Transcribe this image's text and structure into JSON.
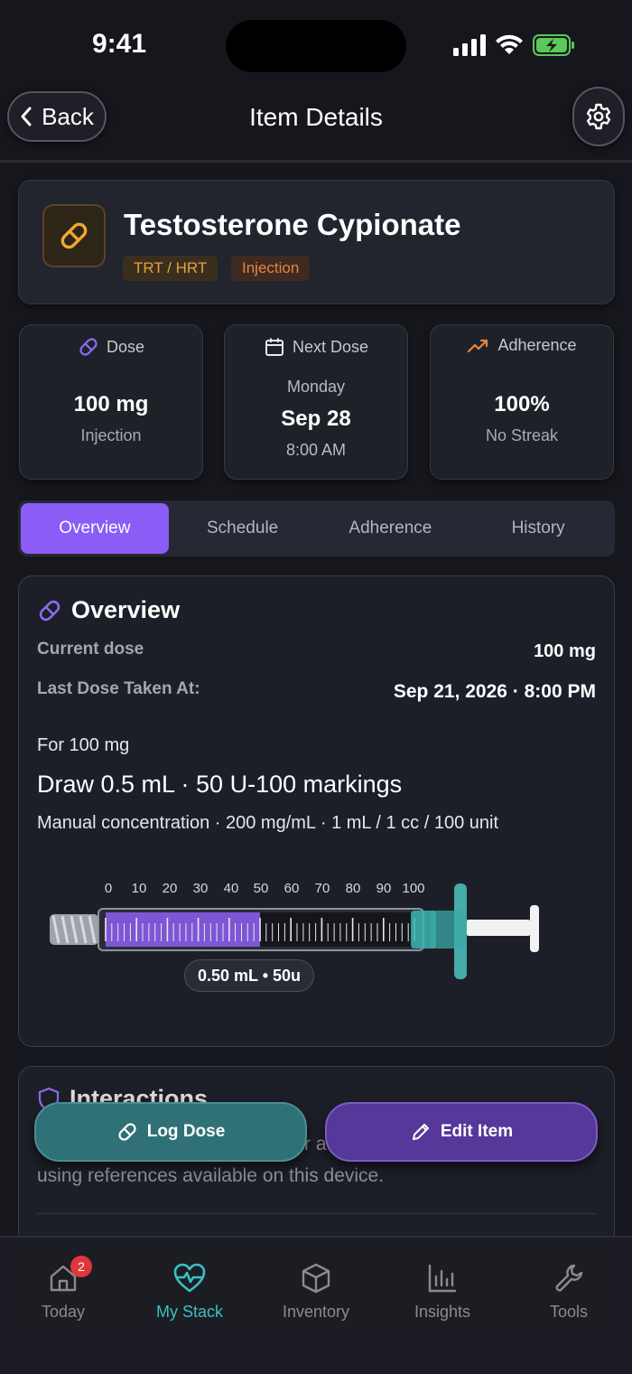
{
  "status_bar": {
    "time": "9:41"
  },
  "header": {
    "back_label": "Back",
    "title": "Item Details"
  },
  "item": {
    "name": "Testosterone Cypionate",
    "tags": [
      "TRT / HRT",
      "Injection"
    ],
    "icon": "pill-icon",
    "accent": "#e7a13a"
  },
  "stats": {
    "dose": {
      "label": "Dose",
      "value": "100 mg",
      "sub": "Injection"
    },
    "next_dose": {
      "label": "Next Dose",
      "day": "Monday",
      "date": "Sep 28",
      "time": "8:00 AM"
    },
    "adherence": {
      "label": "Adherence",
      "value": "100%",
      "sub": "No Streak"
    }
  },
  "tabs": [
    "Overview",
    "Schedule",
    "Adherence",
    "History"
  ],
  "active_tab": "Overview",
  "overview": {
    "title": "Overview",
    "current_dose_label": "Current dose",
    "current_dose_value": "100 mg",
    "last_dose_label": "Last Dose Taken At:",
    "last_dose_value": "Sep 21, 2026 · 8:00 PM",
    "for_line": "For 100 mg",
    "draw_line": "Draw 0.5 mL · 50 U-100 markings",
    "concentration_line": "Manual concentration · 200 mg/mL · 1 mL / 1 cc / 100 unit",
    "syringe": {
      "tick_labels": [
        "0",
        "10",
        "20",
        "30",
        "40",
        "50",
        "60",
        "70",
        "80",
        "90",
        "100"
      ],
      "fill_units": 50,
      "max_units": 100,
      "pill": "0.50 mL • 50u",
      "fill_color": "#7d56d6"
    }
  },
  "interactions": {
    "title": "Interactions",
    "text_fragment_1": "r a",
    "text_line_2": "using references available on this device."
  },
  "actions": {
    "log_dose": "Log Dose",
    "edit_item": "Edit Item"
  },
  "tab_bar": {
    "items": [
      {
        "label": "Today",
        "icon": "home-icon",
        "badge": "2"
      },
      {
        "label": "My Stack",
        "icon": "heart-pulse-icon"
      },
      {
        "label": "Inventory",
        "icon": "box-icon"
      },
      {
        "label": "Insights",
        "icon": "bar-chart-icon"
      },
      {
        "label": "Tools",
        "icon": "wrench-icon"
      }
    ],
    "active": "My Stack",
    "active_color": "#38c1c6"
  }
}
